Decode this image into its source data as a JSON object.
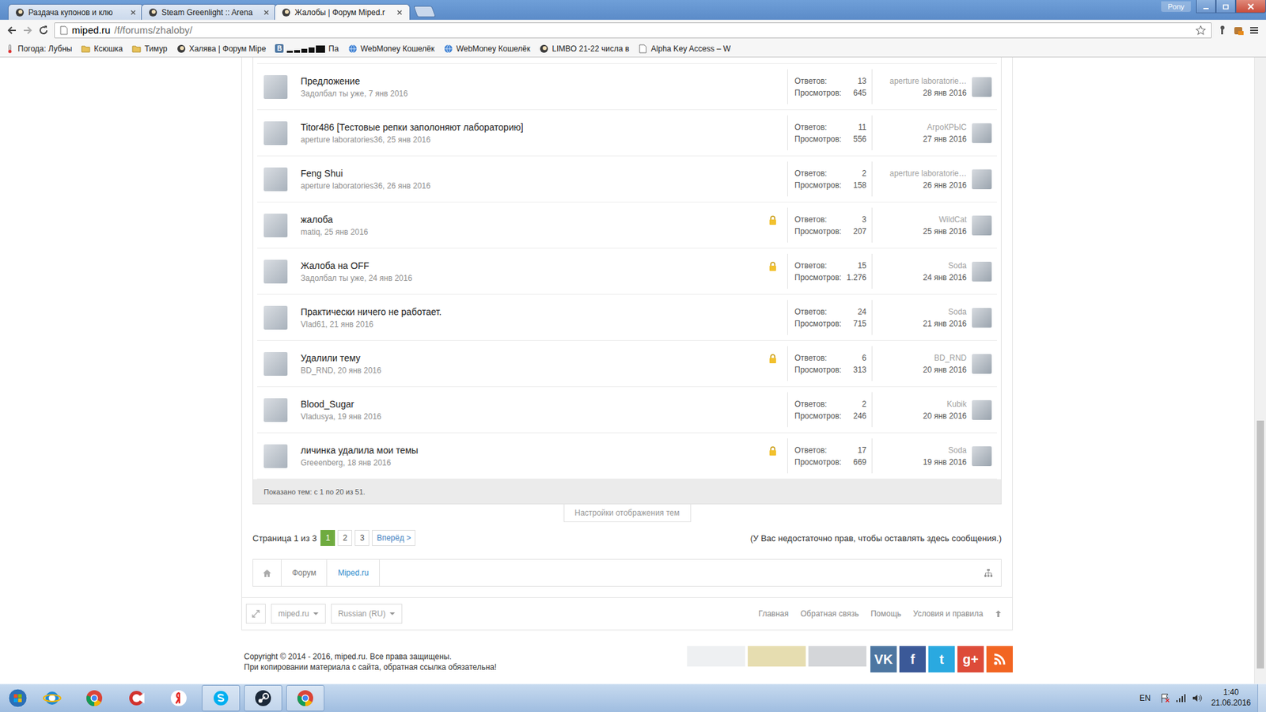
{
  "window": {
    "profile": "Pony"
  },
  "tabs": [
    {
      "label": "Раздача купонов и клю",
      "selected": false
    },
    {
      "label": "Steam Greenlight :: Arena",
      "selected": false
    },
    {
      "label": "Жалобы | Форум Miped.r",
      "selected": true
    }
  ],
  "address": {
    "host": "miped.ru",
    "path": "/f/forums/zhaloby/"
  },
  "bookmarks": [
    {
      "label": "Погода: Лубны",
      "kind": "weather"
    },
    {
      "label": "Ксюшка",
      "kind": "folder"
    },
    {
      "label": "Тимур",
      "kind": "folder"
    },
    {
      "label": "Халява | Форум Mipe",
      "kind": "site"
    },
    {
      "label": "Па",
      "icon": "В",
      "kind": "redacted"
    },
    {
      "label": "WebMoney Кошелёк",
      "kind": "wm"
    },
    {
      "label": "WebMoney Кошелёк",
      "kind": "wm"
    },
    {
      "label": "LIMBO 21-22 числа в",
      "kind": "site"
    },
    {
      "label": "Alpha Key Access – W",
      "kind": "page"
    }
  ],
  "stat_labels": {
    "replies": "Ответов:",
    "views": "Просмотров:"
  },
  "threads": [
    {
      "title": "Предложение",
      "byline": "Задолбал ты уже, 7 янв 2016",
      "locked": false,
      "replies": "13",
      "views": "645",
      "last_user": "aperture laboratorie…",
      "last_date": "28 янв 2016"
    },
    {
      "title": "Titor486 [Тестовые репки заполоняют лабораторию]",
      "byline": "aperture laboratories36, 25 янв 2016",
      "locked": false,
      "replies": "11",
      "views": "556",
      "last_user": "АгроКРЫС",
      "last_date": "27 янв 2016"
    },
    {
      "title": "Feng Shui",
      "byline": "aperture laboratories36, 26 янв 2016",
      "locked": false,
      "replies": "2",
      "views": "158",
      "last_user": "aperture laboratorie…",
      "last_date": "26 янв 2016"
    },
    {
      "title": "жалоба",
      "byline": "matiq, 25 янв 2016",
      "locked": true,
      "replies": "3",
      "views": "207",
      "last_user": "WildCat",
      "last_date": "25 янв 2016"
    },
    {
      "title": "Жалоба на OFF",
      "byline": "Задолбал ты уже, 24 янв 2016",
      "locked": true,
      "replies": "15",
      "views": "1.276",
      "last_user": "Soda",
      "last_date": "24 янв 2016"
    },
    {
      "title": "Практически ничего не работает.",
      "byline": "Vlad61, 21 янв 2016",
      "locked": false,
      "replies": "24",
      "views": "715",
      "last_user": "Soda",
      "last_date": "21 янв 2016"
    },
    {
      "title": "Удалили тему",
      "byline": "BD_RND, 20 янв 2016",
      "locked": true,
      "replies": "6",
      "views": "313",
      "last_user": "BD_RND",
      "last_date": "20 янв 2016"
    },
    {
      "title": "Blood_Sugar",
      "byline": "Vladusya, 19 янв 2016",
      "locked": false,
      "replies": "2",
      "views": "246",
      "last_user": "Kubik",
      "last_date": "20 янв 2016"
    },
    {
      "title": "личинка удалила мои темы",
      "byline": "Greeenberg, 18 янв 2016",
      "locked": true,
      "replies": "17",
      "views": "669",
      "last_user": "Soda",
      "last_date": "19 янв 2016"
    }
  ],
  "summary": "Показано тем: с 1 по 20 из 51.",
  "display_settings": "Настройки отображения тем",
  "pagination": {
    "label": "Страница 1 из 3",
    "pages": [
      {
        "label": "1",
        "selected": true
      },
      {
        "label": "2",
        "selected": false
      },
      {
        "label": "3",
        "selected": false
      }
    ],
    "next": "Вперёд >"
  },
  "no_permission": "(У Вас недостаточно прав, чтобы оставлять здесь сообщения.)",
  "breadcrumb": [
    {
      "label": "Форум",
      "current": false
    },
    {
      "label": "Miped.ru",
      "current": true
    }
  ],
  "footer": {
    "selects": [
      "miped.ru",
      "Russian (RU)"
    ],
    "links": [
      "Главная",
      "Обратная связь",
      "Помощь",
      "Условия и правила"
    ],
    "copyright": [
      "Copyright © 2014 - 2016, miped.ru. Все права защищены.",
      "При копировании материала с сайта, обратная ссылка обязательна!"
    ],
    "social": [
      {
        "kind": "text",
        "label": "VK",
        "color": "#4d76a1"
      },
      {
        "kind": "text",
        "label": "f",
        "color": "#3b5998"
      },
      {
        "kind": "text",
        "label": "t",
        "color": "#2aa9e0"
      },
      {
        "kind": "text",
        "label": "g+",
        "color": "#dd4b39"
      },
      {
        "kind": "rss",
        "color": "#f26522"
      }
    ]
  },
  "taskbar": {
    "apps": [
      {
        "kind": "ie",
        "running": false
      },
      {
        "kind": "chrome",
        "running": false
      },
      {
        "kind": "ccleaner",
        "running": false
      },
      {
        "kind": "yandex",
        "running": false
      },
      {
        "kind": "skype",
        "running": true
      },
      {
        "kind": "steam",
        "running": true
      },
      {
        "kind": "chrome",
        "running": true
      }
    ],
    "lang": "EN",
    "time": "1:40",
    "date": "21.06.2016"
  }
}
